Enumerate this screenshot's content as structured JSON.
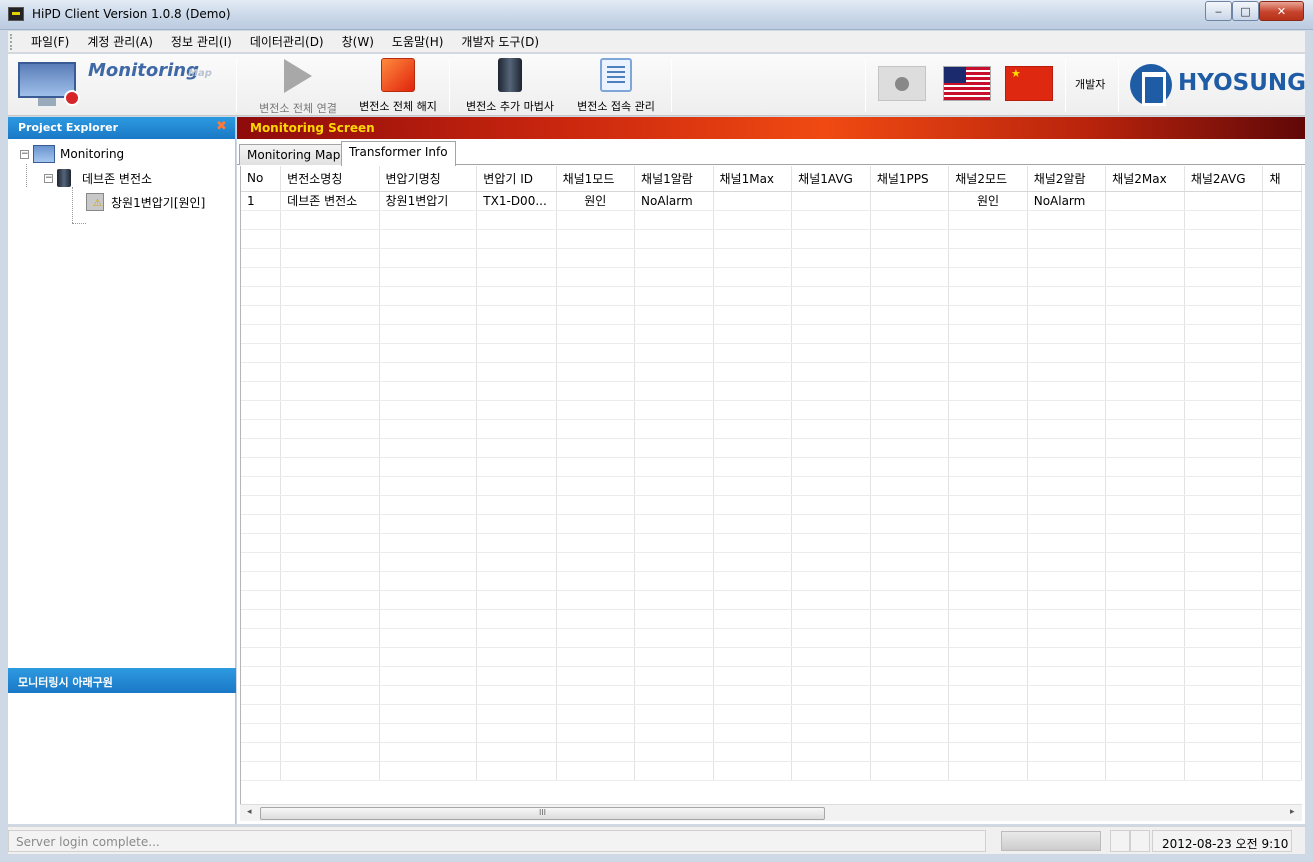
{
  "window": {
    "title": "HiPD Client Version 1.0.8 (Demo)",
    "min_glyph": "‒",
    "max_glyph": "□",
    "close_glyph": "✕"
  },
  "menu": [
    "파일(F)",
    "계정 관리(A)",
    "정보 관리(I)",
    "데이터관리(D)",
    "창(W)",
    "도움말(H)",
    "개발자 도구(D)"
  ],
  "toolbar": {
    "logo_text": "Monitoring",
    "logo_sub": "Map",
    "connect_all": "변전소 전체 연결",
    "disconnect_all": "변전소 전체 해지",
    "add_wizard": "변전소 추가 마법사",
    "connection_mgmt": "변전소 접속 관리",
    "developer": "개발자",
    "brand": "HYOSUNG"
  },
  "left_panel": {
    "title": "Project Explorer",
    "close_glyph": "✖",
    "tree": {
      "root": "Monitoring",
      "substation": "데브존 변전소",
      "transformer": "창원1변압기[원인]",
      "expander_glyph": "−"
    },
    "lower_title": "모니터링시 아래구원"
  },
  "main": {
    "screen_title": "Monitoring Screen",
    "tabs": [
      "Monitoring Map",
      "Transformer Info"
    ],
    "active_tab": "Transformer Info",
    "grid": {
      "columns": [
        "No",
        "변전소명칭",
        "변압기명칭",
        "변압기 ID",
        "채널1모드",
        "채널1알람",
        "채널1Max",
        "채널1AVG",
        "채널1PPS",
        "채널2모드",
        "채널2알람",
        "채널2Max",
        "채널2AVG",
        "채"
      ],
      "rows": [
        [
          "1",
          "데브존 변전소",
          "창원1변압기",
          "TX1-D00...",
          "원인",
          "NoAlarm",
          "",
          "",
          "",
          "원인",
          "NoAlarm",
          "",
          "",
          ""
        ]
      ],
      "empty_rows": 30
    },
    "scroll": {
      "left_arrow": "◂",
      "right_arrow": "▸",
      "thumb_grip": "III"
    }
  },
  "status": {
    "message": "Server login complete...",
    "datetime": "2012-08-23 오전 9:10"
  }
}
